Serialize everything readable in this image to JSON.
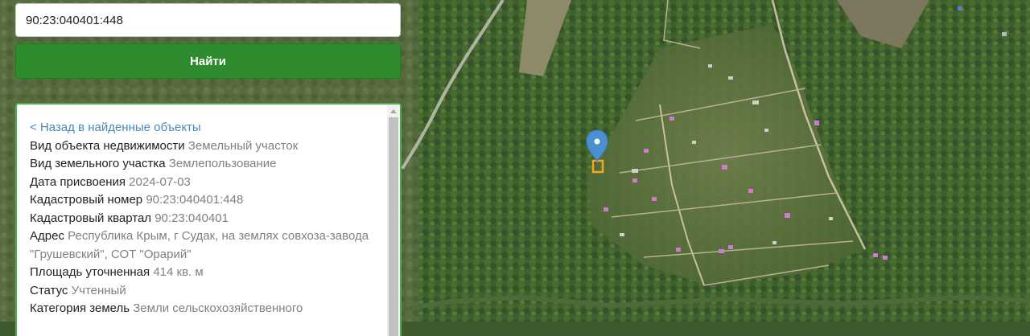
{
  "search": {
    "value": "90:23:040401:448",
    "button_label": "Найти"
  },
  "info": {
    "back_link": "< Назад в найденные объекты",
    "rows": [
      {
        "label": "Вид объекта недвижимости",
        "value": "Земельный участок"
      },
      {
        "label": "Вид земельного участка",
        "value": "Землепользование"
      },
      {
        "label": "Дата присвоения",
        "value": "2024-07-03"
      },
      {
        "label": "Кадастровый номер",
        "value": "90:23:040401:448"
      },
      {
        "label": "Кадастровый квартал",
        "value": "90:23:040401"
      },
      {
        "label": "Адрес",
        "value": "Республика Крым, г Судак, на землях совхоза-завода \"Грушевский\", СОТ \"Орарий\""
      },
      {
        "label": "Площадь уточненная",
        "value": "414 кв. м"
      },
      {
        "label": "Статус",
        "value": "Учтенный"
      },
      {
        "label": "Категория земель",
        "value": "Земли сельскохозяйственного"
      }
    ]
  },
  "map": {
    "marker_color": "#4a90d0",
    "parcel_color": "#f5a623"
  }
}
